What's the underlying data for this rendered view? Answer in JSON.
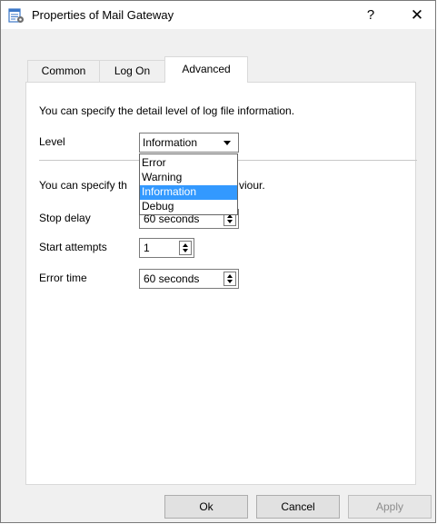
{
  "window": {
    "title": "Properties of Mail Gateway",
    "help_label": "?",
    "close_label": "✕"
  },
  "tabs": [
    {
      "label": "Common",
      "active": false
    },
    {
      "label": "Log On",
      "active": false
    },
    {
      "label": "Advanced",
      "active": true
    }
  ],
  "log_section": {
    "description": "You can specify the detail level of log file information.",
    "level_label": "Level",
    "level_value": "Information",
    "level_options": [
      "Error",
      "Warning",
      "Information",
      "Debug"
    ],
    "selected_option": "Information"
  },
  "service_section": {
    "description_start": "You can specify th",
    "description_end": "viour.",
    "stop_delay_label": "Stop delay",
    "stop_delay_value": "60 seconds",
    "start_attempts_label": "Start attempts",
    "start_attempts_value": "1",
    "error_time_label": "Error time",
    "error_time_value": "60 seconds"
  },
  "buttons": {
    "ok": "Ok",
    "cancel": "Cancel",
    "apply": "Apply"
  },
  "colors": {
    "selection": "#3399ff",
    "window_bg": "#f0f0f0"
  },
  "icons": {
    "app": "properties-icon",
    "dropdown": "chevron-down-icon",
    "spinner": "spinner-arrows-icon"
  }
}
